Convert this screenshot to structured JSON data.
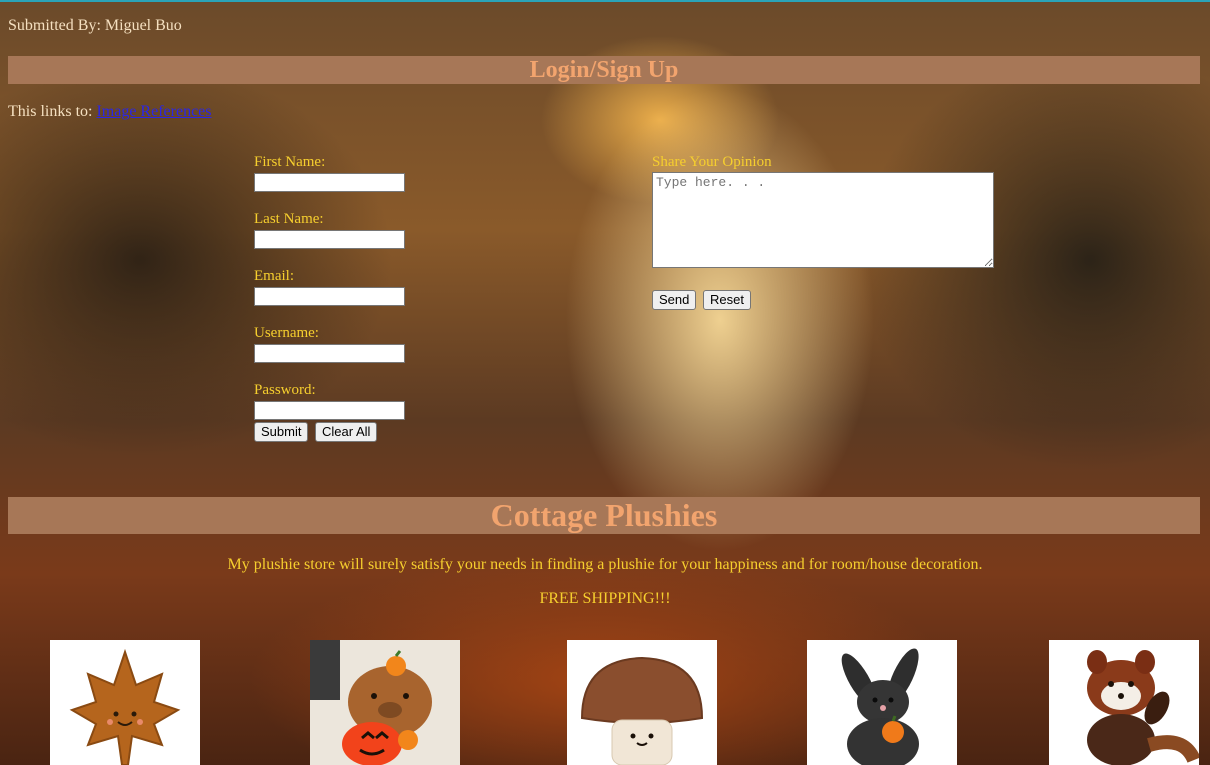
{
  "header": {
    "submitted_by": "Submitted By: Miguel Buo"
  },
  "login_banner": {
    "title": "Login/Sign Up"
  },
  "links": {
    "prefix": "This links to: ",
    "link_text": "Image References"
  },
  "form": {
    "first_name_label": "First Name:",
    "last_name_label": "Last Name:",
    "email_label": "Email:",
    "username_label": "Username:",
    "password_label": "Password:",
    "first_name_value": "",
    "last_name_value": "",
    "email_value": "",
    "username_value": "",
    "password_value": "",
    "submit_label": "Submit",
    "clear_label": "Clear All"
  },
  "opinion": {
    "label": "Share Your Opinion",
    "placeholder": "Type here. . .",
    "send_label": "Send",
    "reset_label": "Reset"
  },
  "store": {
    "title": "Cottage Plushies",
    "description": "My plushie store will surely satisfy your needs in finding a plushie for your happiness and for room/house decoration.",
    "shipping": "FREE SHIPPING!!!"
  },
  "products": [
    {
      "icon": "maple-leaf-plushie-icon"
    },
    {
      "icon": "capybara-plushie-icon"
    },
    {
      "icon": "mushroom-plushie-icon"
    },
    {
      "icon": "bunny-plushie-icon"
    },
    {
      "icon": "red-panda-plushie-icon"
    }
  ],
  "colors": {
    "banner_bg": "#a77757",
    "banner_text": "#f2a46e",
    "label_text": "#f6cf2e",
    "link": "#2b26e6"
  }
}
